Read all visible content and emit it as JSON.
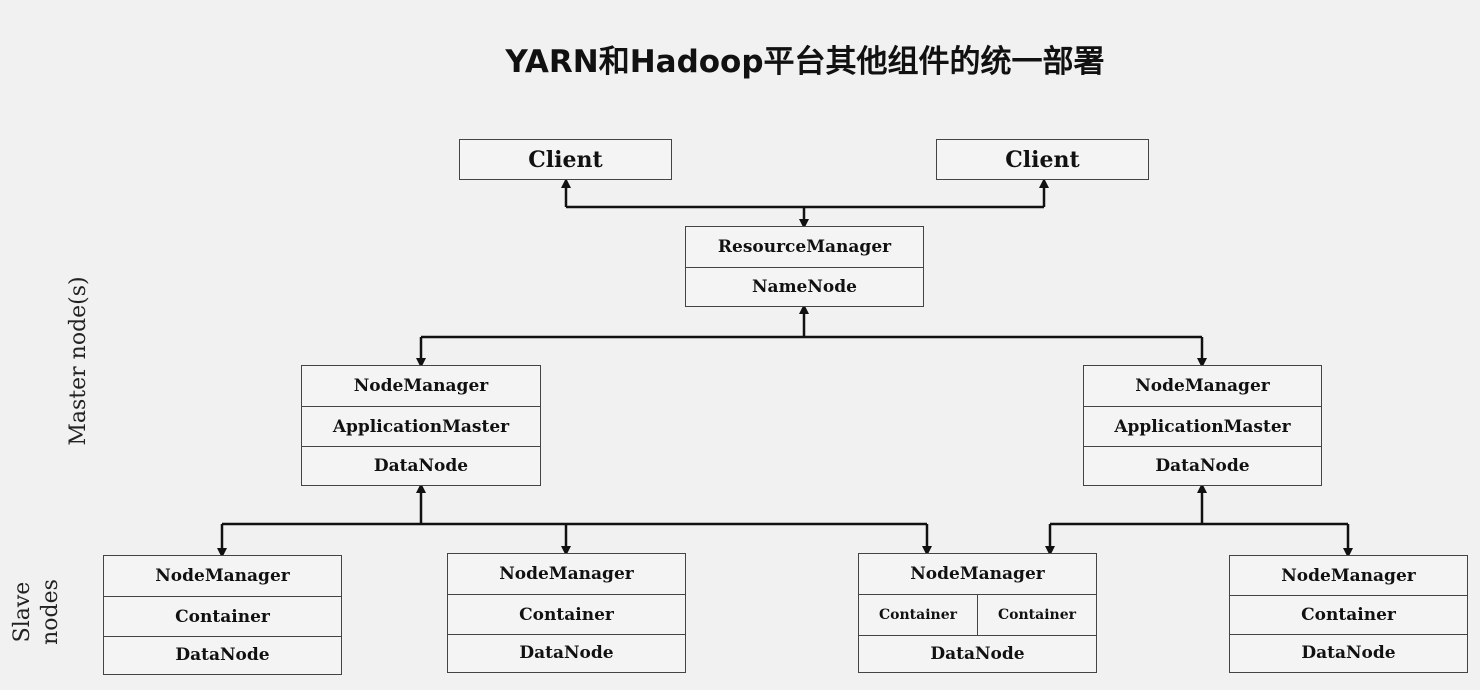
{
  "title": "YARN和Hadoop平台其他组件的统一部署",
  "side_labels": {
    "master": "Master node(s)",
    "slave_line1": "Slave",
    "slave_line2": "nodes"
  },
  "clients": [
    "Client",
    "Client"
  ],
  "master_node": {
    "resource_manager": "ResourceManager",
    "name_node": "NameNode"
  },
  "am_nodes": [
    {
      "node_manager": "NodeManager",
      "application_master": "ApplicationMaster",
      "data_node": "DataNode"
    },
    {
      "node_manager": "NodeManager",
      "application_master": "ApplicationMaster",
      "data_node": "DataNode"
    }
  ],
  "slave_nodes": [
    {
      "node_manager": "NodeManager",
      "containers": [
        "Container"
      ],
      "data_node": "DataNode"
    },
    {
      "node_manager": "NodeManager",
      "containers": [
        "Container"
      ],
      "data_node": "DataNode"
    },
    {
      "node_manager": "NodeManager",
      "containers": [
        "Container",
        "Container"
      ],
      "data_node": "DataNode"
    },
    {
      "node_manager": "NodeManager",
      "containers": [
        "Container"
      ],
      "data_node": "DataNode"
    }
  ]
}
